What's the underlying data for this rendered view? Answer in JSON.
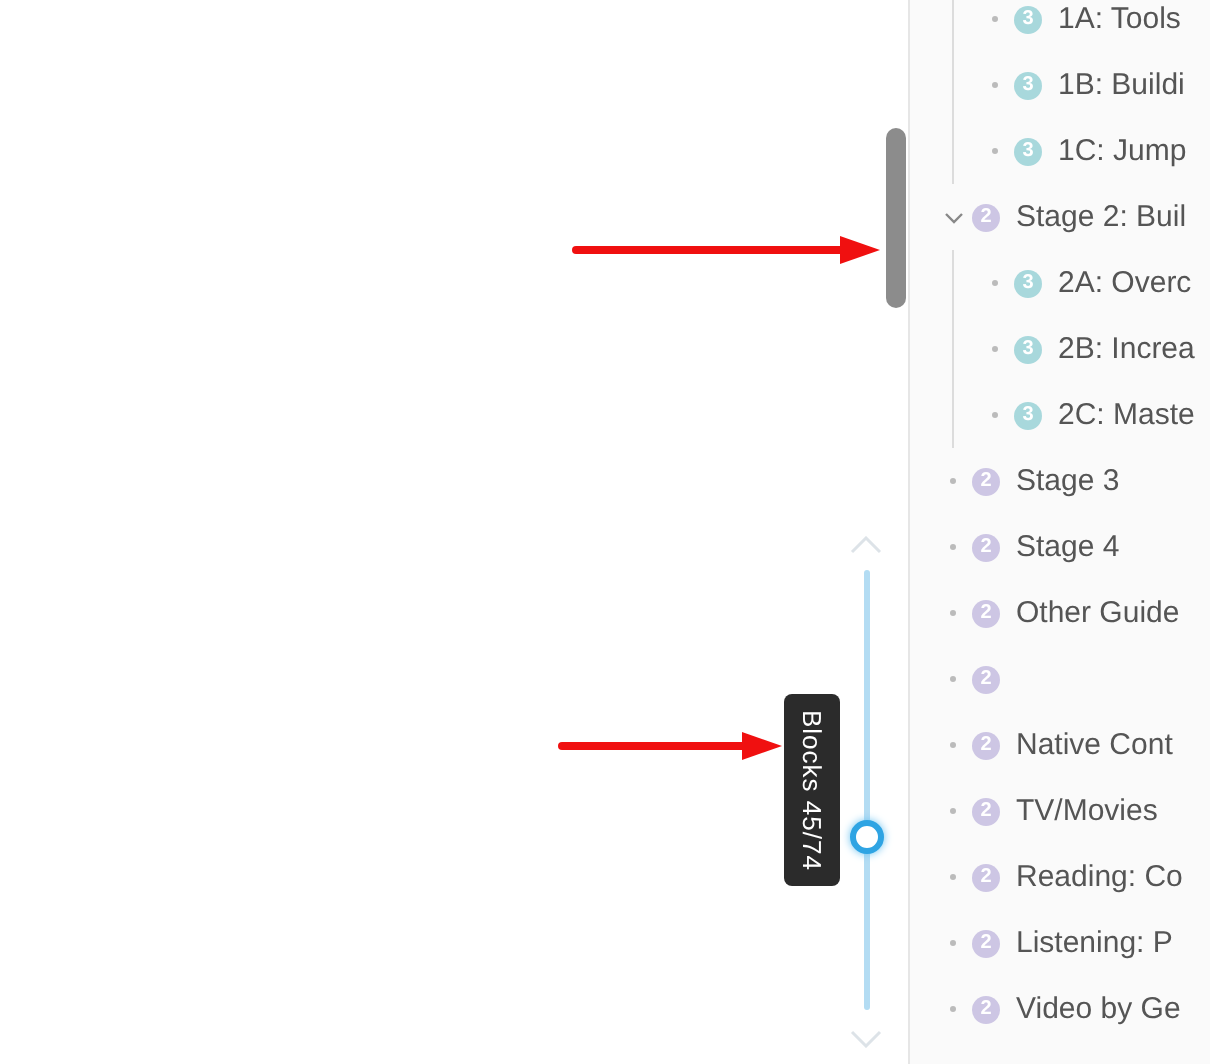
{
  "block_slider": {
    "tooltip": "Blocks 45/74"
  },
  "outline": {
    "continued_children": [
      {
        "label": "1A: Tools",
        "badge": "3",
        "color": "#a8d8dc"
      },
      {
        "label": "1B: Buildi",
        "badge": "3",
        "color": "#a8d8dc"
      },
      {
        "label": "1C: Jump",
        "badge": "3",
        "color": "#a8d8dc"
      }
    ],
    "items": [
      {
        "label": "Stage 2: Buil",
        "badge": "2",
        "color": "#cdc6e4",
        "expanded": true,
        "children": [
          {
            "label": "2A: Overc",
            "badge": "3",
            "color": "#a8d8dc"
          },
          {
            "label": "2B: Increa",
            "badge": "3",
            "color": "#a8d8dc"
          },
          {
            "label": "2C: Maste",
            "badge": "3",
            "color": "#a8d8dc"
          }
        ]
      },
      {
        "label": "Stage 3",
        "badge": "2",
        "color": "#cdc6e4",
        "expanded": false
      },
      {
        "label": "Stage 4",
        "badge": "2",
        "color": "#cdc6e4",
        "expanded": false
      },
      {
        "label": "Other Guide",
        "badge": "2",
        "color": "#cdc6e4",
        "expanded": false
      },
      {
        "badge": "2",
        "color": "#cdc6e4",
        "expanded": false
      },
      {
        "label": "Native Cont",
        "badge": "2",
        "color": "#cdc6e4",
        "expanded": false
      },
      {
        "label": "TV/Movies",
        "badge": "2",
        "color": "#cdc6e4",
        "expanded": false
      },
      {
        "label": "Reading: Co",
        "badge": "2",
        "color": "#cdc6e4",
        "expanded": false
      },
      {
        "label": "Listening: P",
        "badge": "2",
        "color": "#cdc6e4",
        "expanded": false
      },
      {
        "label": "Video by Ge",
        "badge": "2",
        "color": "#cdc6e4",
        "expanded": false
      }
    ]
  }
}
